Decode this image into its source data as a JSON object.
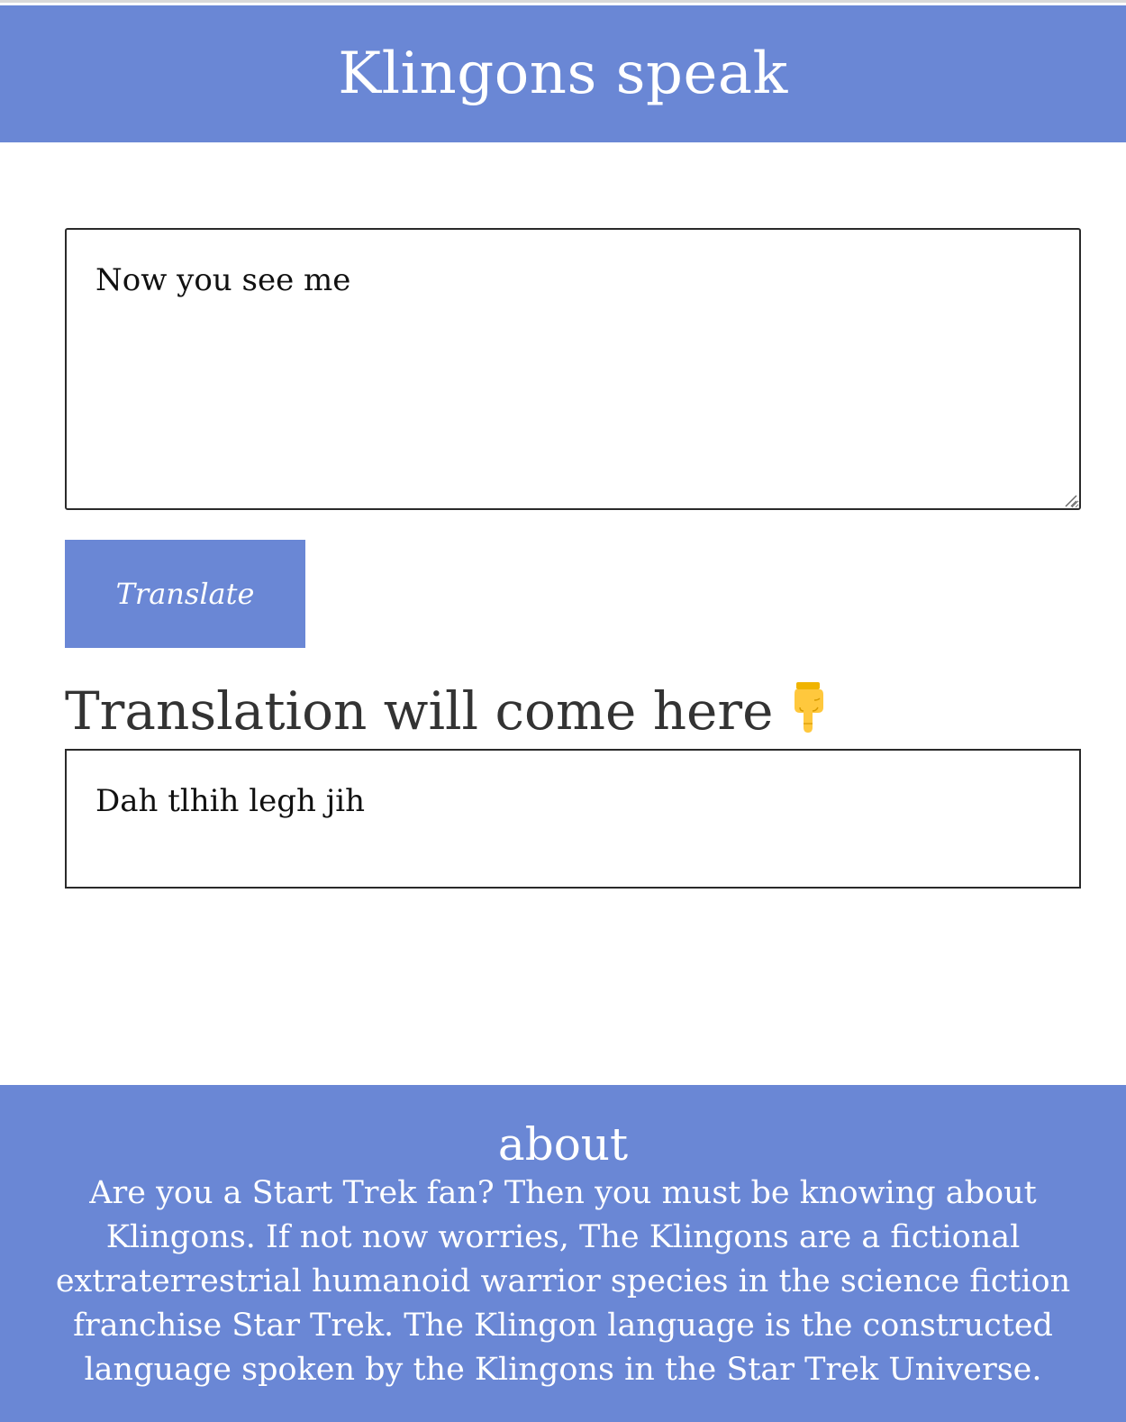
{
  "header": {
    "title": "Klingons speak"
  },
  "translator": {
    "input_value": "Now you see me",
    "button_label": "Translate",
    "output_heading": "Translation will come here",
    "output_heading_emoji": "👇",
    "output_text": "Dah tlhih legh jih"
  },
  "about": {
    "heading": "about",
    "text": "Are you a Start Trek fan? Then you must be knowing about Klingons. If not now worries, The Klingons are a fictional extraterrestrial humanoid warrior species in the science fiction franchise Star Trek. The Klingon language is the constructed language spoken by the Klingons in the Star Trek Universe."
  },
  "colors": {
    "accent": "#6a87d5",
    "text_dark": "#333333",
    "border": "#2a2a2a"
  },
  "icons": {
    "pointer": "backhand-index-pointing-down-icon",
    "resize": "resize-grip-icon"
  }
}
